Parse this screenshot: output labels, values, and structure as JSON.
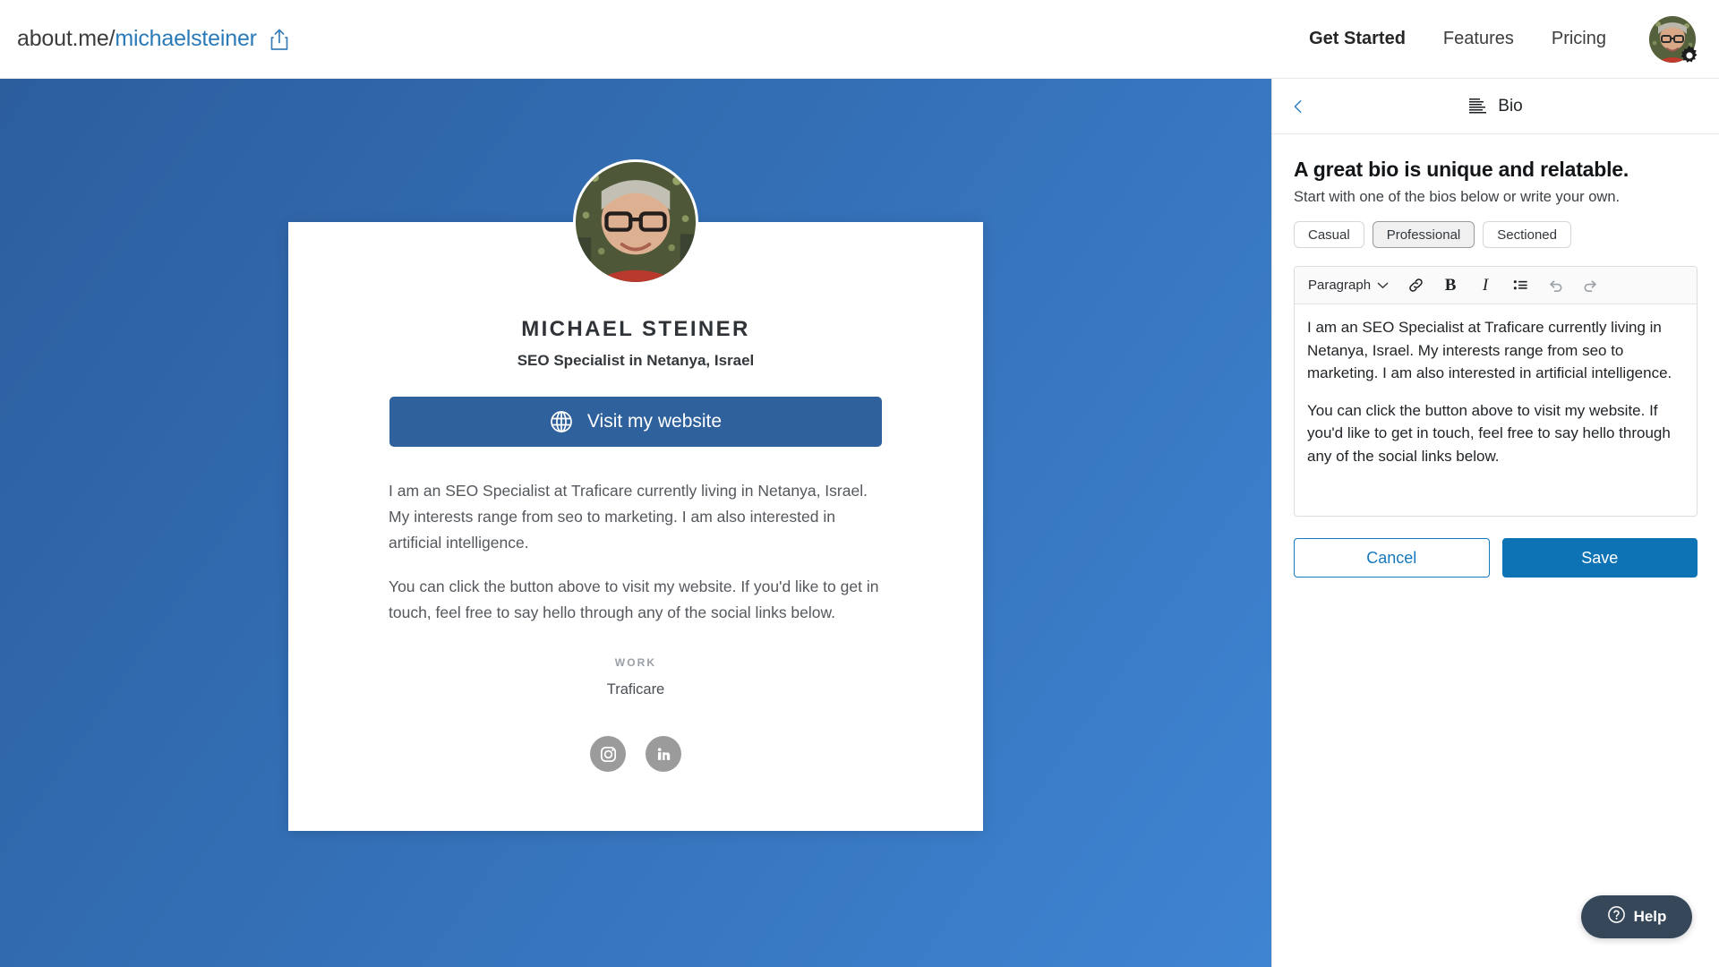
{
  "topbar": {
    "url_prefix": "about.me/",
    "url_handle": "michaelsteiner",
    "share_icon": "share-icon",
    "nav": [
      {
        "label": "Get Started",
        "active": true
      },
      {
        "label": "Features",
        "active": false
      },
      {
        "label": "Pricing",
        "active": false
      }
    ],
    "avatar_icon": "user-avatar",
    "gear_icon": "gear-icon"
  },
  "profile": {
    "name": "MICHAEL STEINER",
    "title": "SEO Specialist in Netanya, Israel",
    "cta_label": "Visit my website",
    "cta_icon": "globe-icon",
    "bio_paragraphs": [
      "I am an SEO Specialist at Traficare currently living in Netanya, Israel. My interests range from seo to marketing. I am also interested in artificial intelligence.",
      "You can click the button above to visit my website. If you'd like to get in touch, feel free to say hello through any of the social links below."
    ],
    "work_label": "WORK",
    "work_value": "Traficare",
    "socials": [
      {
        "name": "instagram-icon",
        "label": "Instagram"
      },
      {
        "name": "linkedin-icon",
        "label": "LinkedIn"
      }
    ]
  },
  "panel": {
    "back_icon": "chevron-left-icon",
    "header_icon": "bio-lines-icon",
    "header_title": "Bio",
    "heading": "A great bio is unique and relatable.",
    "subheading": "Start with one of the bios below or write your own.",
    "style_tabs": [
      {
        "label": "Casual",
        "selected": false
      },
      {
        "label": "Professional",
        "selected": true
      },
      {
        "label": "Sectioned",
        "selected": false
      }
    ],
    "toolbar": {
      "block_format": "Paragraph",
      "chevron_icon": "chevron-down-icon",
      "link_label": "\u0000",
      "bold_label": "B",
      "italic_label": "I",
      "link_icon": "link-icon",
      "list_icon": "bullet-list-icon",
      "undo_icon": "undo-icon",
      "redo_icon": "redo-icon"
    },
    "editor_paragraphs": [
      "I am an SEO Specialist at Traficare currently living in Netanya, Israel. My interests range from seo to marketing. I am also interested in artificial intelligence.",
      "You can click the button above to visit my website. If you'd like to get in touch, feel free to say hello through any of the social links below."
    ],
    "cancel_label": "Cancel",
    "save_label": "Save"
  },
  "help": {
    "label": "Help",
    "icon": "question-circle-icon"
  },
  "colors": {
    "brand_blue": "#2a7ab8",
    "save_blue": "#0d73b5",
    "cta_blue": "#2f619c",
    "bg_gradient_start": "#2c5e9e",
    "bg_gradient_end": "#3f84d2",
    "help_dark": "#37475a",
    "social_gray": "#9b9b9b"
  }
}
